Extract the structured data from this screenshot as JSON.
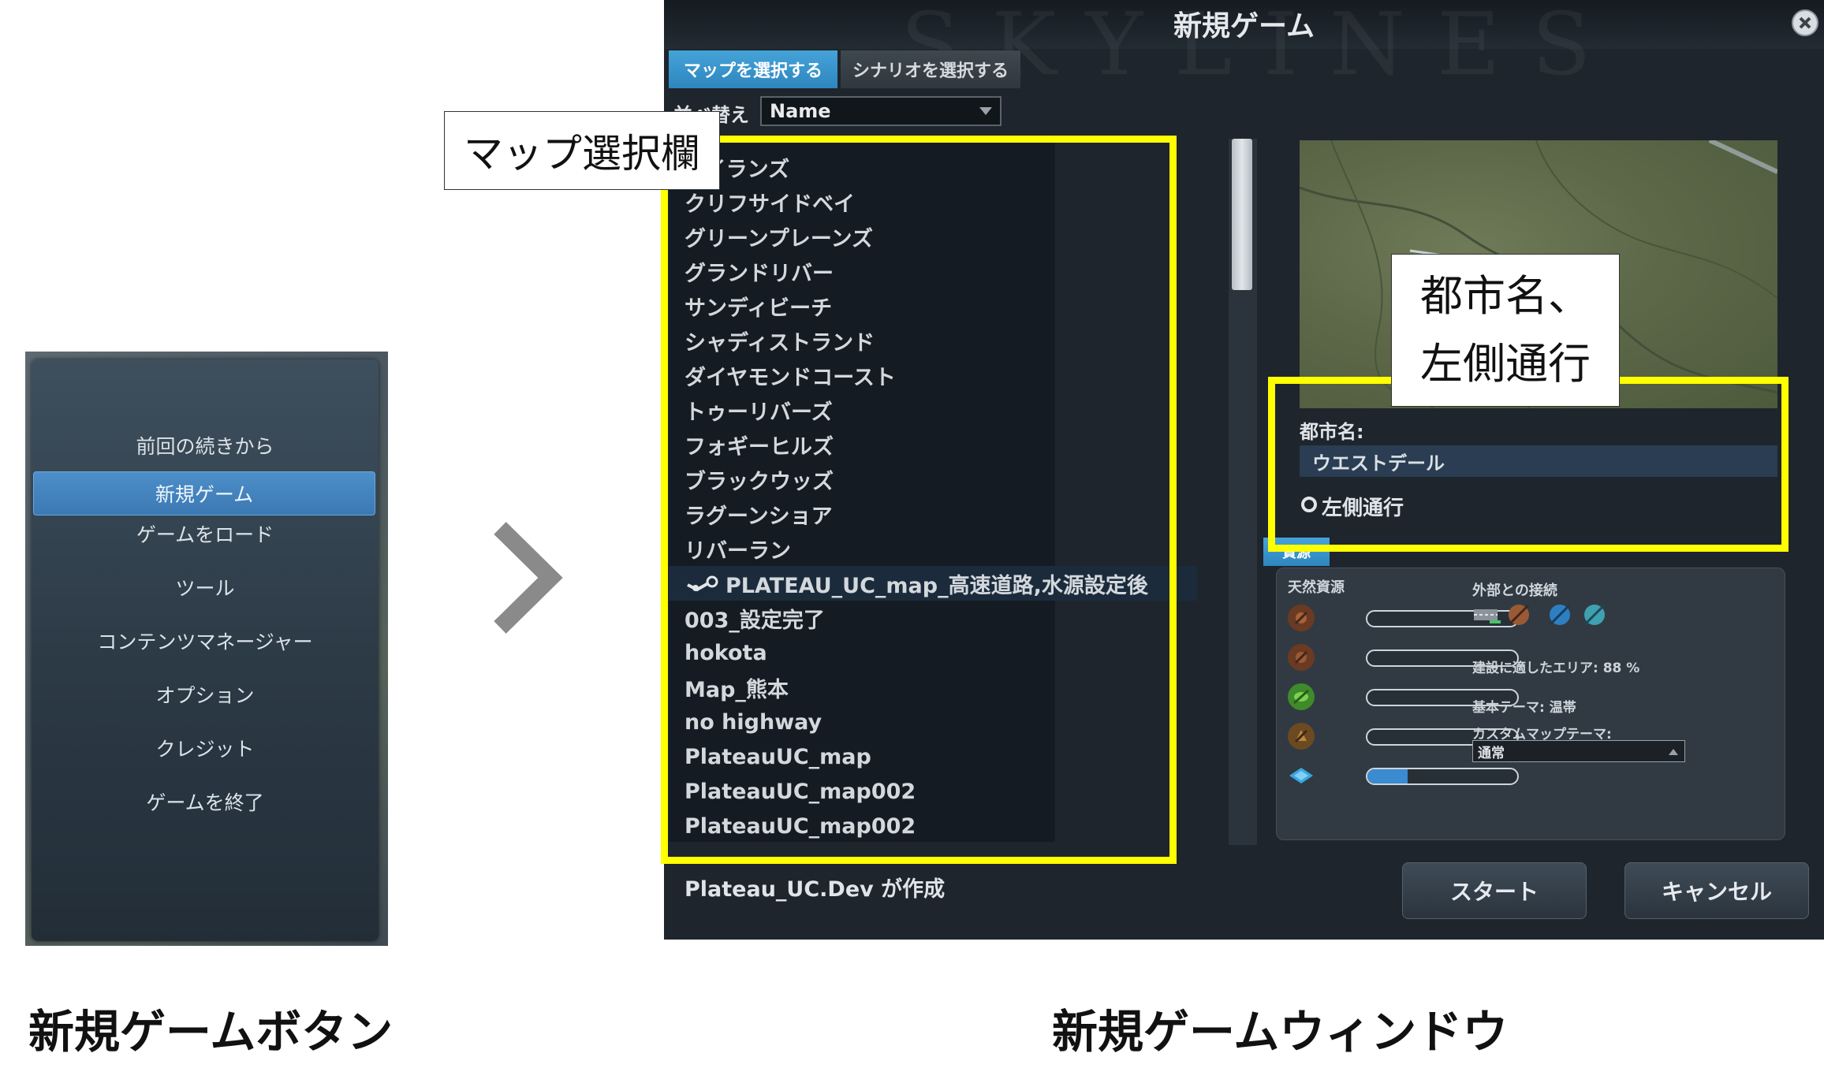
{
  "main_menu": {
    "items": [
      {
        "label": "前回の続きから",
        "selected": false
      },
      {
        "label": "新規ゲーム",
        "selected": true
      },
      {
        "label": "ゲームをロード",
        "selected": false
      },
      {
        "label": "ツール",
        "selected": false
      },
      {
        "label": "コンテンツマネージャー",
        "selected": false
      },
      {
        "label": "オプション",
        "selected": false
      },
      {
        "label": "クレジット",
        "selected": false
      },
      {
        "label": "ゲームを終了",
        "selected": false
      }
    ]
  },
  "captions": {
    "left": "新規ゲームボタン",
    "right": "新規ゲームウィンドウ"
  },
  "window": {
    "title": "新規ゲーム",
    "background_text": "SKYLINES",
    "tabs": {
      "map": "マップを選択する",
      "scenario": "シナリオを選択する"
    },
    "sort": {
      "label": "並べ替え",
      "value": "Name"
    },
    "map_list": [
      "アイランズ",
      "クリフサイドベイ",
      "グリーンプレーンズ",
      "グランドリバー",
      "サンディビーチ",
      "シャディストランド",
      "ダイヤモンドコースト",
      "トゥーリバーズ",
      "フォギーヒルズ",
      "ブラックウッズ",
      "ラグーンショア",
      "リバーラン",
      "PLATEAU_UC_map_高速道路,水源設定後",
      "003_設定完了",
      "hokota",
      "Map_熊本",
      "no highway",
      "PlateauUC_map",
      "PlateauUC_map002",
      "PlateauUC_map002"
    ],
    "selected_map_index": 12,
    "list_scroll_fraction": 0.0,
    "city": {
      "label": "都市名:",
      "value": "ウエストデール",
      "left_hand_traffic_label": "左側通行",
      "left_hand_traffic_checked": false
    },
    "resources": {
      "tab": "資源",
      "natural_resources_label": "天然資源",
      "bars": [
        {
          "icon": "ore-icon",
          "value": 0.0
        },
        {
          "icon": "oil-icon",
          "value": 0.0
        },
        {
          "icon": "fertile-land-icon",
          "value": 0.0
        },
        {
          "icon": "forest-icon",
          "value": 0.0
        },
        {
          "icon": "water-icon",
          "value": 0.27
        }
      ],
      "connections_label": "外部との接続",
      "connection_icons": [
        "highway-icon",
        "train-icon",
        "ship-icon",
        "plane-icon"
      ],
      "buildable_area": "建設に適したエリア: 88 %",
      "base_theme": "基本テーマ: 温帯",
      "custom_theme_label": "カスタムマップテーマ:",
      "custom_theme_value": "通常"
    },
    "author": "Plateau_UC.Dev が作成",
    "buttons": {
      "start": "スタート",
      "cancel": "キャンセル"
    }
  },
  "annotations": {
    "map_select": "マップ選択欄",
    "city_line1": "都市名、",
    "city_line2": "左側通行"
  },
  "colors": {
    "highlight": "#ffff00",
    "accent_blue": "#3b79b3",
    "window_bg": "#1e252c"
  }
}
